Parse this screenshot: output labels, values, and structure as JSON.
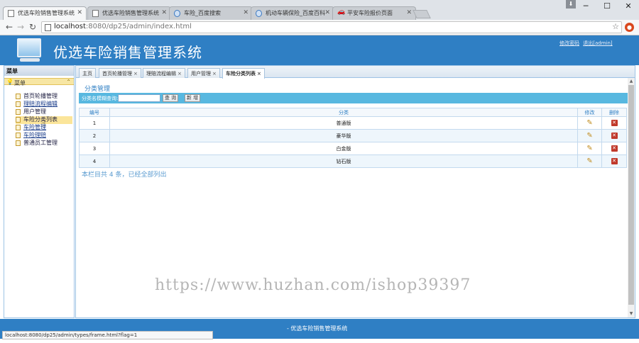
{
  "browser": {
    "tabs": [
      {
        "title": "优选车险销售管理系统",
        "icon": "page-icon"
      },
      {
        "title": "优选车险销售管理系统",
        "icon": "page-icon"
      },
      {
        "title": "车险_百度搜索",
        "icon": "baidu-icon"
      },
      {
        "title": "机动车辆保险_百度百科",
        "icon": "baidu-icon"
      },
      {
        "title": "平安车险报价页面",
        "icon": "car-icon"
      }
    ],
    "url_host": "localhost",
    "url_path": ":8080/dp25/admin/index.html",
    "status_url": "localhost:8080/dp25/admin/types/frame.html?flag=1"
  },
  "app": {
    "title": "优选车险销售管理系统",
    "header_links": [
      "修改密码",
      "退出[admin]"
    ],
    "footer": "- 优选车险销售管理系统"
  },
  "sidebar": {
    "head": "菜单",
    "panel": "菜单",
    "items": [
      {
        "label": "首页轮播管理",
        "style": "normal"
      },
      {
        "label": "理赔流程编辑",
        "style": "link"
      },
      {
        "label": "用户管理",
        "style": "normal"
      },
      {
        "label": "车险分类列表",
        "style": "selected"
      },
      {
        "label": "车险管理",
        "style": "link"
      },
      {
        "label": "车险理赔",
        "style": "link"
      },
      {
        "label": "普通员工管理",
        "style": "normal"
      }
    ]
  },
  "content_tabs": [
    {
      "label": "主页",
      "closable": false
    },
    {
      "label": "首页轮播管理",
      "closable": true
    },
    {
      "label": "理赔流程编辑",
      "closable": true
    },
    {
      "label": "用户管理",
      "closable": true
    },
    {
      "label": "车险分类列表",
      "closable": true,
      "active": true
    }
  ],
  "page": {
    "section_title": "分类管理",
    "search_label": "分类名模糊查询:",
    "search_value": "",
    "query_button": "查 询",
    "add_button": "新 增",
    "columns": {
      "id": "编号",
      "name": "分类",
      "edit": "修改",
      "delete": "删除"
    },
    "rows": [
      {
        "id": "1",
        "name": "普通版"
      },
      {
        "id": "2",
        "name": "豪华版"
      },
      {
        "id": "3",
        "name": "白金版"
      },
      {
        "id": "4",
        "name": "钻石版"
      }
    ],
    "summary": "本栏目共 4 条，已经全部列出"
  },
  "watermark": "https://www.huzhan.com/ishop39397",
  "colors": {
    "brand_blue": "#2f7fc4",
    "search_bar": "#58b8e0",
    "menu_highlight": "#fbe59a"
  }
}
